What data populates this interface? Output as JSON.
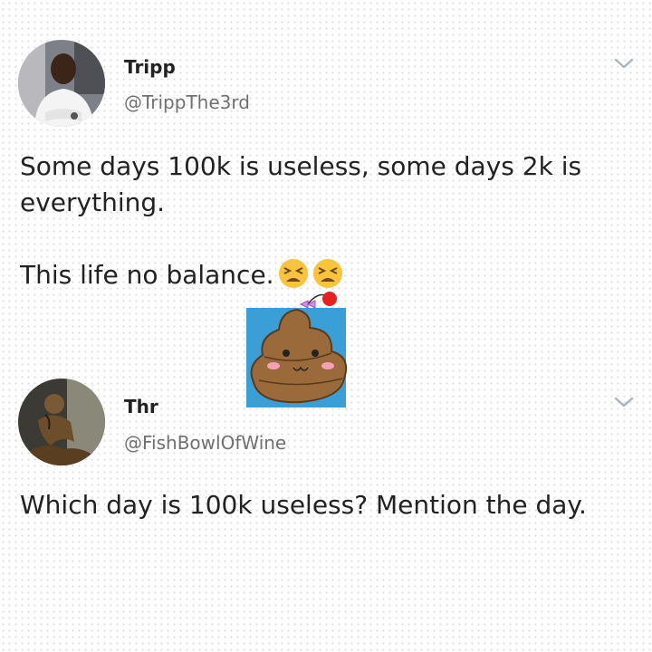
{
  "tweets": [
    {
      "name": "Tripp",
      "handle": "@TrippThe3rd",
      "lines": [
        "Some days 100k is useless, some days 2k is",
        "everything."
      ],
      "line2": "This life no balance.",
      "emojis": [
        "tired-face-emoji",
        "tired-face-emoji"
      ]
    },
    {
      "name": "Thr",
      "handle": "@FishBowlOfWine",
      "lines": [
        "Which day is 100k useless? Mention the day."
      ]
    }
  ],
  "sticker": {
    "icon": "poop-emoji-sticker",
    "accent": "#3a9fd6"
  },
  "colors": {
    "handle": "#707070",
    "text": "#222222",
    "chevron": "#aab4be"
  }
}
